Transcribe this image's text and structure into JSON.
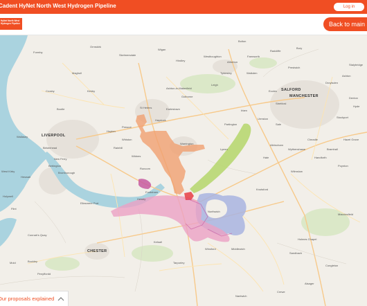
{
  "topbar": {
    "title": "Cadent HyNet North West Hydrogen Pipeline",
    "login_label": "Log in"
  },
  "header": {
    "logo_text": "HyNet North West Hydrogen Pipeline",
    "back_label": "Back to main site"
  },
  "map": {
    "cities": {
      "liverpool": "LIVERPOOL",
      "manchester": "MANCHESTER",
      "salford": "SALFORD",
      "chester": "CHESTER"
    },
    "towns": {
      "t1": "Formby",
      "t2": "Ormskirk",
      "t3": "Skelmersdale",
      "t4": "Wigan",
      "t5": "Westhoughton",
      "t6": "Bolton",
      "t7": "Farnworth",
      "t8": "Radcliffe",
      "t9": "Bury",
      "t10": "Prestwich",
      "t11": "Maghull",
      "t12": "Kirkby",
      "t13": "Ashton-in-Makerfield",
      "t14": "Golborne",
      "t15": "Leigh",
      "t16": "Tyldesley",
      "t17": "Walkden",
      "t18": "Eccles",
      "t19": "Stretford",
      "t20": "Crosby",
      "t21": "Bootle",
      "t22": "St Helens",
      "t23": "Earlestown",
      "t24": "Irlam",
      "t25": "Sale",
      "t26": "Altrincham",
      "t27": "Wallasey",
      "t28": "Huyton",
      "t29": "Prescot",
      "t30": "Birkenhead",
      "t31": "Widnes",
      "t32": "Warrington",
      "t33": "Lymm",
      "t34": "Hale",
      "t35": "Wilmslow",
      "t36": "West Kirby",
      "t37": "Bebington",
      "t38": "New Ferry",
      "t39": "Runcorn",
      "t40": "Heswall",
      "t41": "Bromborough",
      "t42": "Frodsham",
      "t43": "Helsby",
      "t44": "Ellesmere Port",
      "t45": "Knutsford",
      "t46": "Northwich",
      "t47": "Winsford",
      "t48": "Middlewich",
      "t49": "Tarporley",
      "t50": "Connah's Quay",
      "t51": "Buckley",
      "t52": "Penyffordd",
      "t53": "Sandbach",
      "t54": "Macclesfield",
      "t55": "Congleton",
      "t56": "Mold",
      "t57": "Holmes Chapel",
      "t58": "Stockport",
      "t59": "Cheadle",
      "t60": "Handforth",
      "t61": "Hazel Grove",
      "t62": "Poynton",
      "t63": "Bramhall",
      "t64": "Denton",
      "t65": "Hyde",
      "t66": "Droylsden",
      "t67": "Ashton",
      "t68": "Stalybridge",
      "t69": "Atherton",
      "t70": "Hindley",
      "t71": "Whiston",
      "t72": "Rainhill",
      "t73": "Haydock",
      "t74": "Partington",
      "t75": "Wythenshawe",
      "t76": "Urmston",
      "t77": "Flint",
      "t78": "Holywell",
      "t79": "Kelsall",
      "t80": "Alsager",
      "t81": "Crewe",
      "t82": "Nantwich"
    },
    "route_colors": {
      "orange": "#f0a071",
      "green": "#b5d66b",
      "purple": "#a9b4e0",
      "pink": "#eba1c4",
      "magenta": "#c75aa0",
      "red": "#e8484e"
    }
  },
  "panel": {
    "label": "Our proposals explained"
  }
}
